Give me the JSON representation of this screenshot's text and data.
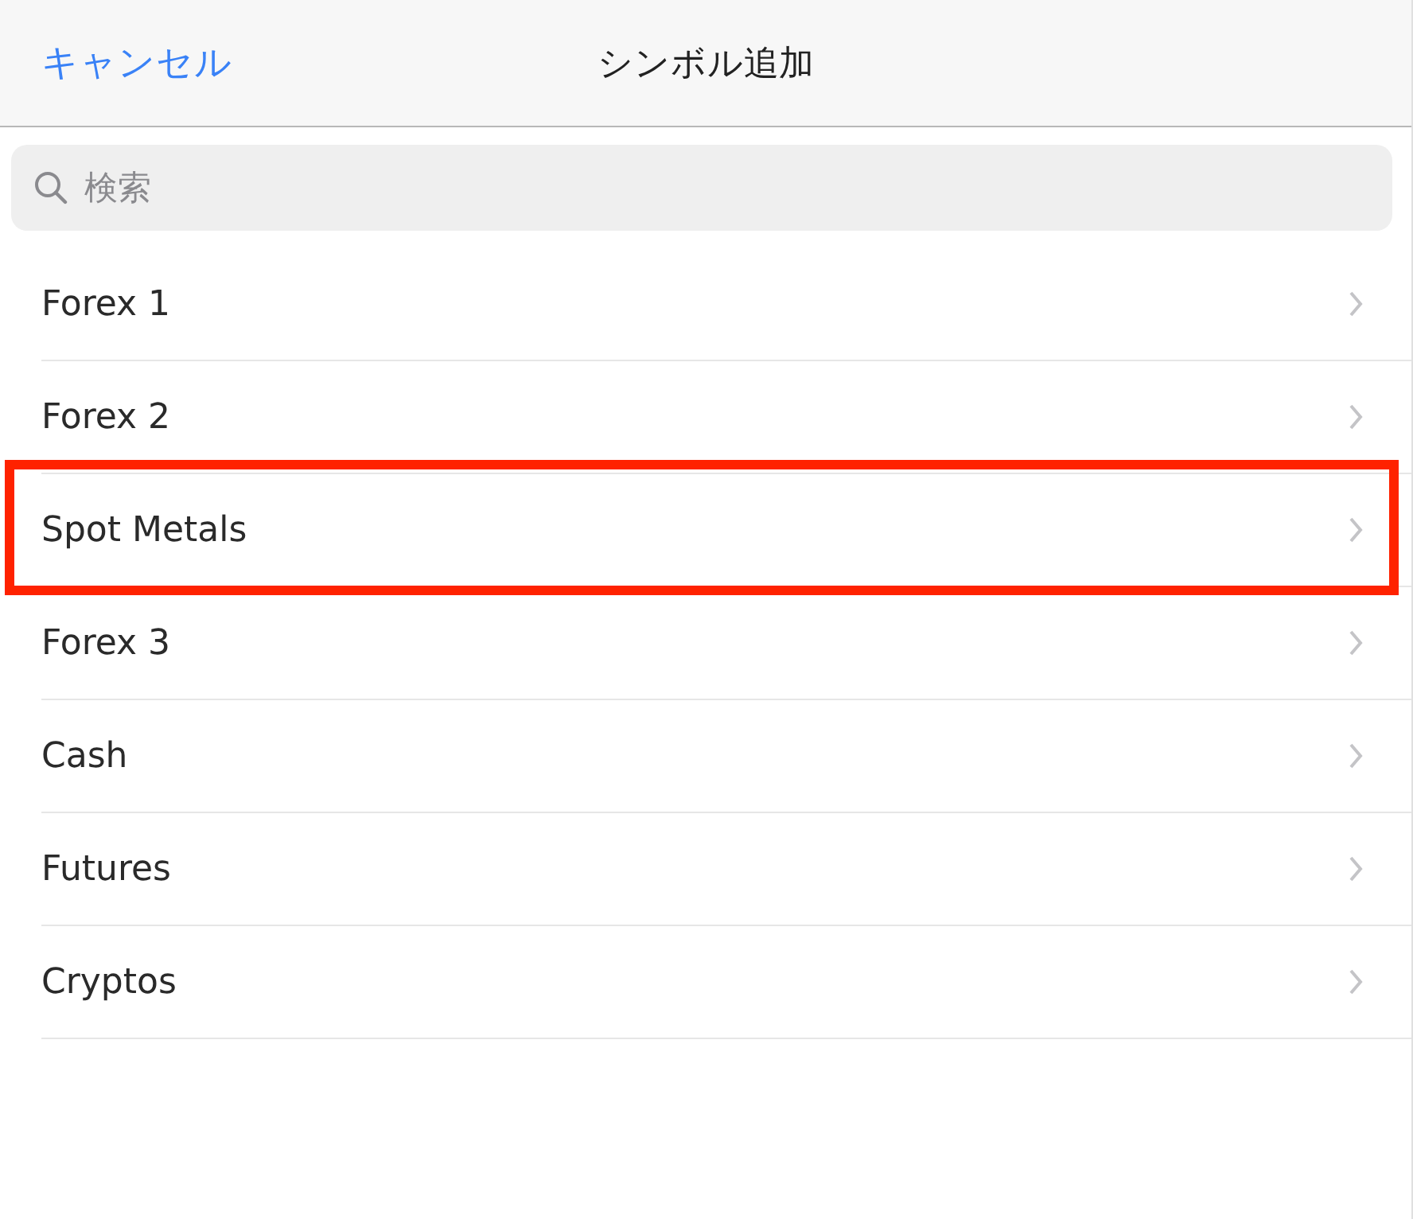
{
  "nav_bar": {
    "cancel": "キャンセル",
    "title": "シンボル追加"
  },
  "search": {
    "placeholder": "検索"
  },
  "items": [
    {
      "label": "Forex 1",
      "highlighted": false
    },
    {
      "label": "Forex 2",
      "highlighted": false
    },
    {
      "label": "Spot Metals",
      "highlighted": true
    },
    {
      "label": "Forex 3",
      "highlighted": false
    },
    {
      "label": "Cash",
      "highlighted": false
    },
    {
      "label": "Futures",
      "highlighted": false
    },
    {
      "label": "Cryptos",
      "highlighted": false
    }
  ]
}
